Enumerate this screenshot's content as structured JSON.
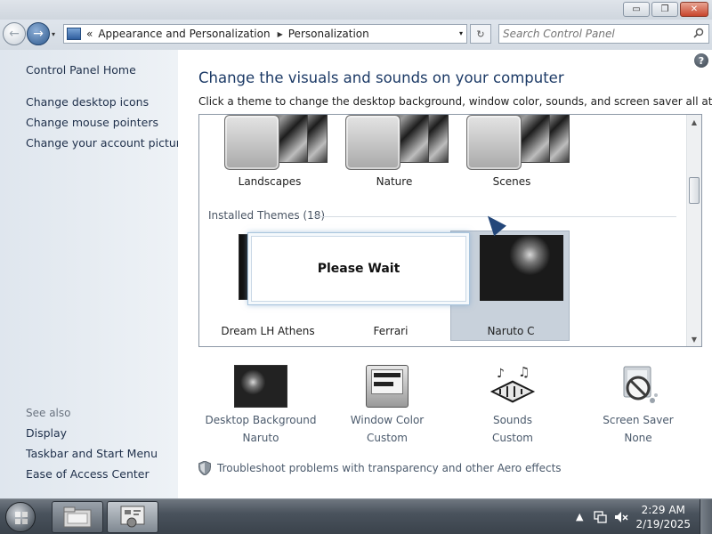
{
  "window": {
    "min_glyph": "▭",
    "max_glyph": "❐",
    "close_glyph": "✕"
  },
  "nav": {
    "back_glyph": "←",
    "forward_glyph": "→",
    "dropdown_glyph": "▾",
    "breadcrumb_lead": "«",
    "breadcrumb": [
      "Appearance and Personalization",
      "Personalization"
    ],
    "breadcrumb_sep": "▶",
    "refresh_glyph": "↻",
    "search_placeholder": "Search Control Panel"
  },
  "sidebar": {
    "home": "Control Panel Home",
    "links": [
      "Change desktop icons",
      "Change mouse pointers",
      "Change your account picture"
    ],
    "see_also": "See also",
    "see_also_links": [
      "Display",
      "Taskbar and Start Menu",
      "Ease of Access Center"
    ]
  },
  "main": {
    "help_glyph": "?",
    "heading": "Change the visuals and sounds on your computer",
    "subheading": "Click a theme to change the desktop background, window color, sounds, and screen saver all at once.",
    "top_themes": [
      "Landscapes",
      "Nature",
      "Scenes"
    ],
    "installed_label": "Installed Themes (18)",
    "installed_themes": [
      "Dream LH Athens",
      "Ferrari",
      "Naruto C"
    ],
    "selected_theme": "Naruto C",
    "dialog_text": "Please Wait",
    "settings": [
      {
        "name": "Desktop Background",
        "value": "Naruto"
      },
      {
        "name": "Window Color",
        "value": "Custom"
      },
      {
        "name": "Sounds",
        "value": "Custom"
      },
      {
        "name": "Screen Saver",
        "value": "None"
      }
    ],
    "troubleshoot": "Troubleshoot problems with transparency and other Aero effects"
  },
  "taskbar": {
    "time": "2:29 AM",
    "date": "2/19/2025",
    "tray_arrow": "▲"
  },
  "colors": {
    "heading": "#1c3a66",
    "link": "#1e2f4a",
    "selected_tile": "#c8d1db"
  }
}
